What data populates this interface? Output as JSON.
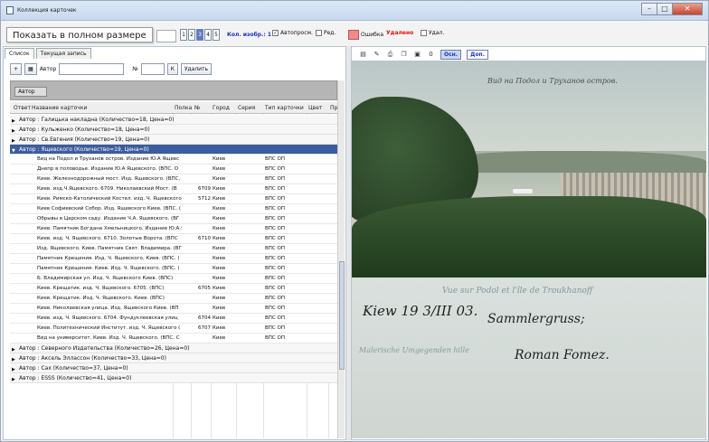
{
  "window": {
    "title": "Коллекция карточек",
    "minimize": "–",
    "maximize": "□",
    "close": "✕"
  },
  "toolbar": {
    "tooltip": "Показать в полном размере",
    "pages": [
      "1",
      "2",
      "3",
      "4",
      "5"
    ],
    "active_page": "3",
    "kol_label": "Кол. изобр.: 1",
    "autoprosm": "Автопросм.",
    "red": "Ред.",
    "error": "Ошибка",
    "deleted": "Удалено",
    "udal": "Удал."
  },
  "tabs": [
    "Список",
    "Текущая запись"
  ],
  "filter": {
    "author_label": "Автор",
    "no_label": "№",
    "k_label": "К",
    "delete_label": "Удалить",
    "plus": "+"
  },
  "group_chip": "Автор",
  "columns": [
    "Ответ",
    "Название карточки",
    "Полка",
    "№",
    "Город",
    "Серия",
    "Тип карточки",
    "Цвет",
    "Пр"
  ],
  "groups_top": [
    "Автор : Галицька накладна (Количество=18, Цена=0)",
    "Автор : Кульженко (Количество=18, Цена=0)",
    "Автор : Св.Евгения (Количество=19, Цена=0)",
    "Автор : Ящевского (Количество=19, Цена=0)"
  ],
  "rows": [
    {
      "name": "Вид на Подол и Труханов остров. Издание Ю.А Ящевс",
      "num": "",
      "city": "Киев",
      "type": "ВПС ОП",
      "color": true
    },
    {
      "name": "Днепр в половодье. Издание Ю.А Ящевского. (ВПС. О",
      "num": "",
      "city": "Киев",
      "type": "ВПС ОП",
      "color": true
    },
    {
      "name": "Киев. Железнодорожный мост. Изд. Ящевского. (ВПС.",
      "num": "",
      "city": "Киев",
      "type": "ВПС ОП",
      "color": true
    },
    {
      "name": "Киев. изд.Ч.Ящевского. 6709. Николаевский Мост. (В",
      "num": "6709",
      "city": "Киев",
      "type": "ВПС ОП",
      "color": true
    },
    {
      "name": "Киев. Римско-Католический Костел. изд. Ч. Ящевского",
      "num": "5712",
      "city": "Киев",
      "type": "ВПС ОП",
      "color": true
    },
    {
      "name": "Киев Софиевский Собор. Изд. Ящевского Киев. (ВПС. (",
      "num": "",
      "city": "Киев",
      "type": "ВПС ОП",
      "color": false
    },
    {
      "name": "Обрывы в Царском саду. Издание Ч.А. Ящевского. (ВГ",
      "num": "",
      "city": "Киев",
      "type": "ВПС ОП",
      "color": true
    },
    {
      "name": "Киев. Памятник Богдана Хмельницкого. Издание Ю.А.Я",
      "num": "",
      "city": "Киев",
      "type": "ВПС ОП",
      "color": true
    },
    {
      "name": "Киев. изд. Ч. Ящевского. 6710. Золотые Ворота. (ВПС",
      "num": "6710",
      "city": "Киев",
      "type": "ВПС ОП",
      "color": true
    },
    {
      "name": "Изд. Ящевского. Киев. Памятник Свят. Владимира. (ВГ",
      "num": "",
      "city": "Киев",
      "type": "ВПС ОП",
      "color": false
    },
    {
      "name": "Памятник Крещения. Изд. Ч. Ящевского. Киев. (ВПС. (",
      "num": "",
      "city": "Киев",
      "type": "ВПС ОП",
      "color": false
    },
    {
      "name": "Памятник Крещения. Киев. Изд. Ч. Ящевского. (ВПС. (",
      "num": "",
      "city": "Киев",
      "type": "ВПС ОП",
      "color": false
    },
    {
      "name": "Б. Владимирская ул. Изд. Ч. Ящевского Киев. (ВПС)",
      "num": "",
      "city": "Киев",
      "type": "ВПС ОП",
      "color": false
    },
    {
      "name": "Киев. Крещатик. изд. Ч. Ящевского. 6705. (ВПС)",
      "num": "6705",
      "city": "Киев",
      "type": "ВПС ОП",
      "color": true
    },
    {
      "name": "Киев. Крещатик. Изд. Ч. Ящевского. Киев. (ВПС)",
      "num": "",
      "city": "Киев",
      "type": "ВПС ОП",
      "color": false
    },
    {
      "name": "Киев. Николаевская улица. Изд. Ящевского Киев. (ВП",
      "num": "",
      "city": "Киев",
      "type": "ВПС ОП",
      "color": true
    },
    {
      "name": "Киев. изд. Ч. Ящевского. 6704. Фундуклеевская улиц",
      "num": "6704",
      "city": "Киев",
      "type": "ВПС ОП",
      "color": true
    },
    {
      "name": "Киев. Политехнический Институт. изд. Ч. Ящевского (",
      "num": "6707",
      "city": "Киев",
      "type": "ВПС ОП",
      "color": true
    },
    {
      "name": "Вид на университет. Киев. Изд. Ч. Ящевского. (ВПС. С",
      "num": "",
      "city": "Киев",
      "type": "ВПС ОП",
      "color": false
    }
  ],
  "groups_bottom": [
    "Автор : Северного Издательства (Количество=26, Цена=0)",
    "Автор : Аксель Эллассон (Количество=33, Цена=0)",
    "Автор : Сах (Количество=37, Цена=0)",
    "Автор : ESSS (Количество=41, Цена=0)"
  ],
  "image_tools": {
    "icons": [
      "print-icon",
      "edit-icon",
      "printer-icon",
      "copy-icon",
      "save-icon"
    ],
    "zero": "0",
    "mode_osn": "Осн.",
    "mode_dop": "Доп."
  },
  "postcard": {
    "caption_top": "Вид на Подол и Труханов остров.",
    "caption_bottom": "Vue sur Podol et l'île de Troukhanoff",
    "hand_date": "Kiew 19 3/III 03.",
    "hand_greeting": "Sammlergruss;",
    "hand_name": "Roman Fomez.",
    "hand_small": "Malerische Umgegenden hille"
  },
  "colors": {
    "accent": "#3b5d9c",
    "link": "#1c34b8",
    "error": "#f08a8a",
    "deleted": "#dd1111"
  }
}
